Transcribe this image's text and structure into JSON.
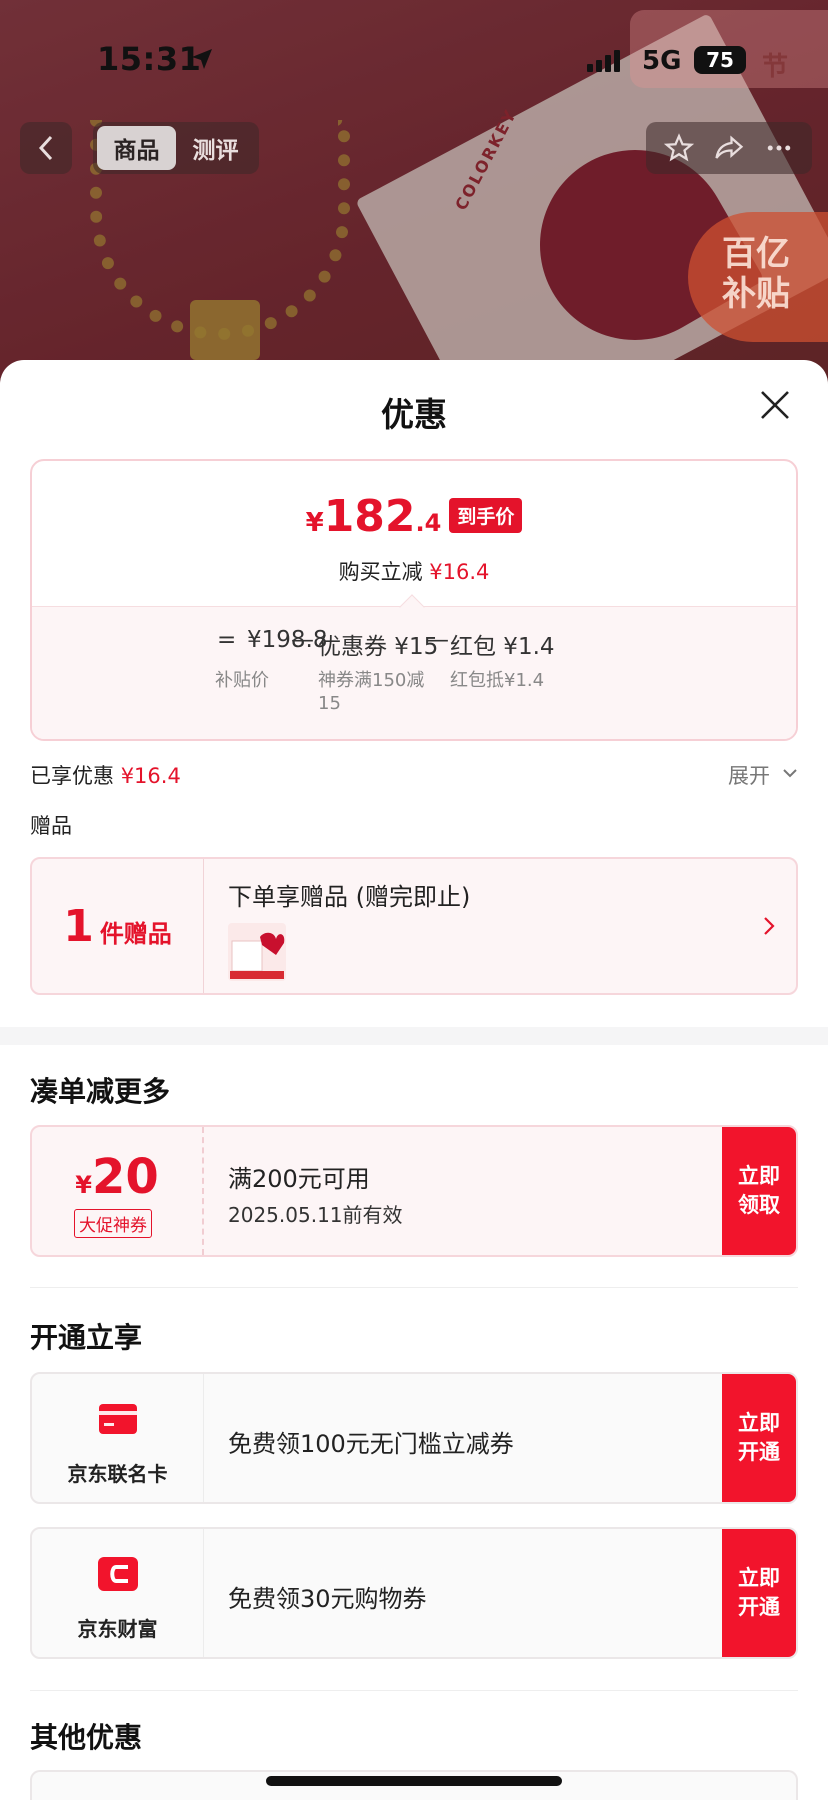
{
  "status_bar": {
    "time": "15:31",
    "network": "5G",
    "battery": "75",
    "festival_tag": "节"
  },
  "nav": {
    "tabs": [
      {
        "label": "商品"
      },
      {
        "label": "测评"
      }
    ],
    "subsidy_line1": "百亿",
    "subsidy_line2": "补贴"
  },
  "product_bg": {
    "brand": "COLORKEY"
  },
  "sheet": {
    "title": "优惠",
    "price": {
      "yen": "¥",
      "integer": "182",
      "decimal": ".4",
      "tag": "到手价",
      "save_label": "购买立减",
      "save_amount": "¥16.4"
    },
    "formula": {
      "eq": "=",
      "minus": "—",
      "base_value": "¥198.8",
      "base_label": "补贴价",
      "coupon_value": "优惠券 ¥15",
      "coupon_desc_line1": "神券满150减",
      "coupon_desc_line2": "15",
      "redpack_value": "红包 ¥1.4",
      "redpack_desc": "红包抵¥1.4"
    },
    "enjoyed_label": "已享优惠",
    "enjoyed_amount": "¥16.4",
    "expand_label": "展开",
    "gift_section_title": "赠品",
    "gift": {
      "count": "1",
      "unit": "件赠品",
      "description": "下单享赠品 (赠完即止)"
    },
    "combine_title": "凑单减更多",
    "coupon": {
      "yen": "¥",
      "amount": "20",
      "tag": "大促神券",
      "condition": "满200元可用",
      "validity": "2025.05.11前有效",
      "cta": "立即领取"
    },
    "open_title": "开通立享",
    "members": [
      {
        "name": "京东联名卡",
        "text": "免费领100元无门槛立减券",
        "cta": "立即开通",
        "icon": "credit-card-icon",
        "color": "#f2142c"
      },
      {
        "name": "京东财富",
        "text": "免费领30元购物券",
        "cta": "立即开通",
        "icon": "wallet-icon",
        "color": "#f2142c"
      }
    ],
    "other_title": "其他优惠"
  }
}
